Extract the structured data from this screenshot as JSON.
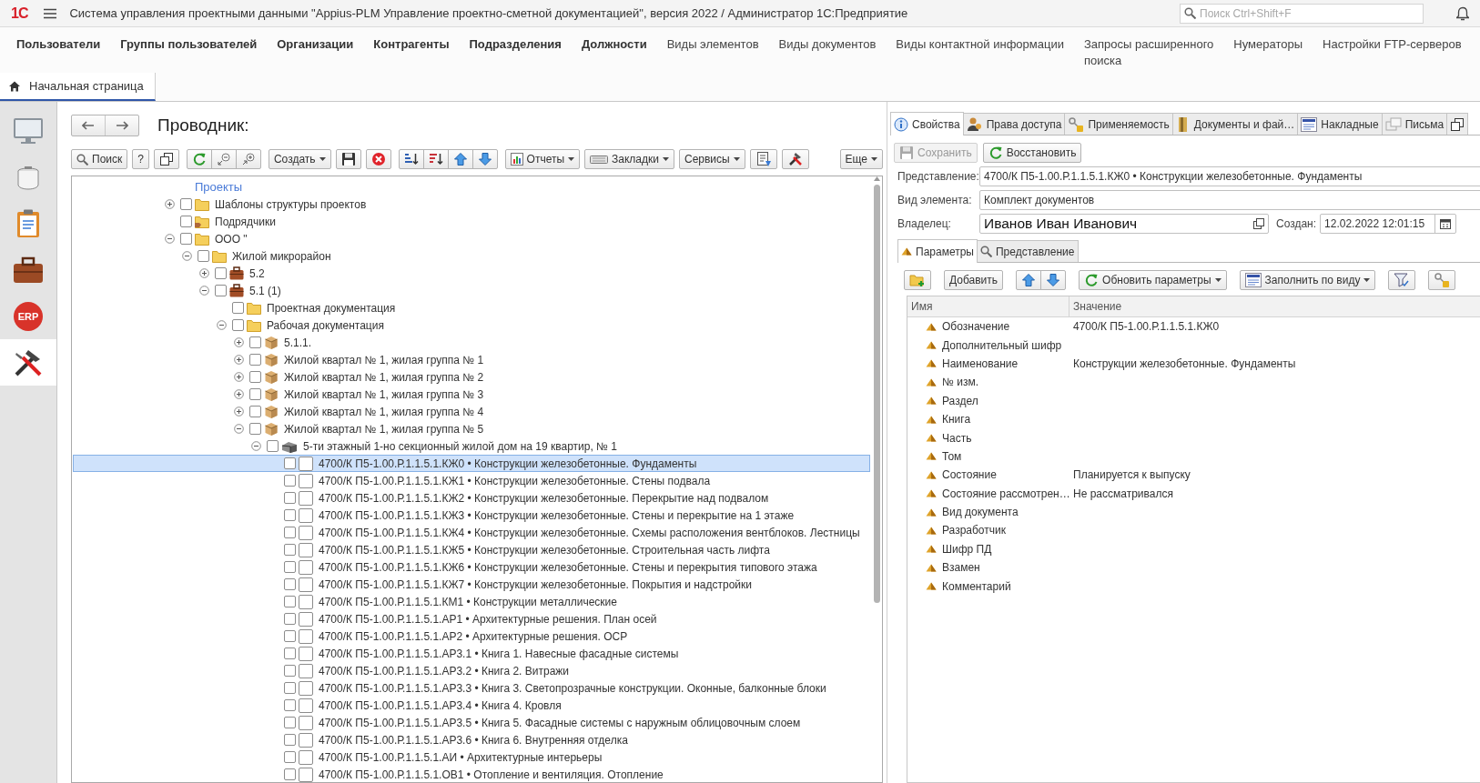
{
  "title_bar": {
    "logo": "1С",
    "title": "Система управления проектными данными \"Appius-PLM Управление проектно-сметной документацией\", версия 2022 / Администратор 1С:Предприятие",
    "search": {
      "placeholder": "Поиск Ctrl+Shift+F"
    }
  },
  "nav_bar": {
    "items": [
      {
        "label": "Пользователи",
        "emphasized": true
      },
      {
        "label": "Группы пользователей",
        "emphasized": true
      },
      {
        "label": "Организации",
        "emphasized": true
      },
      {
        "label": "Контрагенты",
        "emphasized": true
      },
      {
        "label": "Подразделения",
        "emphasized": true
      },
      {
        "label": "Должности",
        "emphasized": true
      },
      {
        "label": "Виды элементов",
        "emphasized": false
      },
      {
        "label": "Виды документов",
        "emphasized": false
      },
      {
        "label": "Виды контактной информации",
        "emphasized": false
      },
      {
        "label": "Запросы расширенного\nпоиска",
        "emphasized": false
      },
      {
        "label": "Нумераторы",
        "emphasized": false
      },
      {
        "label": "Настройки FTP-серверов",
        "emphasized": false
      }
    ]
  },
  "open_tabs": [
    {
      "label": "Начальная страница",
      "selected": true
    }
  ],
  "sidebar": {
    "items": [
      {
        "kind": "monitor",
        "selected": false
      },
      {
        "kind": "pot",
        "selected": false
      },
      {
        "kind": "clipboard",
        "selected": false
      },
      {
        "kind": "briefcase",
        "selected": false
      },
      {
        "kind": "erp",
        "label": "ERP",
        "selected": false
      },
      {
        "kind": "tools",
        "selected": true
      }
    ]
  },
  "explorer": {
    "title": "Проводник:",
    "toolbar": [
      {
        "kind": "search",
        "label": "Поиск"
      },
      {
        "kind": "help",
        "label": "?"
      },
      {
        "kind": "copy"
      },
      {
        "kind": "group",
        "items": [
          {
            "kind": "refresh"
          },
          {
            "kind": "collapse"
          },
          {
            "kind": "expand"
          }
        ]
      },
      {
        "kind": "create",
        "label": "Создать"
      },
      {
        "kind": "save"
      },
      {
        "kind": "cancel"
      },
      {
        "kind": "group",
        "items": [
          {
            "kind": "sort-asc"
          },
          {
            "kind": "sort-desc"
          },
          {
            "kind": "move-up"
          },
          {
            "kind": "move-down"
          }
        ]
      },
      {
        "kind": "reports",
        "label": "Отчеты"
      },
      {
        "kind": "bookmarks",
        "label": "Закладки"
      },
      {
        "kind": "services",
        "label": "Сервисы"
      },
      {
        "kind": "list-settings"
      },
      {
        "kind": "tools"
      },
      {
        "kind": "more",
        "label": "Еще"
      }
    ],
    "tree": {
      "label": "Проекты",
      "selected": false,
      "children": [
        {
          "label": "Шаблоны структуры проектов",
          "kind": "folder",
          "expanded": false,
          "checked": false,
          "selected": false
        },
        {
          "label": "Подрядчики",
          "kind": "shared-folder",
          "checked": false,
          "selected": false
        },
        {
          "label": "ООО \"",
          "kind": "folder",
          "expanded": true,
          "checked": false,
          "selected": false,
          "children": [
            {
              "label": "Жилой микрорайон",
              "kind": "folder",
              "expanded": true,
              "checked": false,
              "selected": false,
              "children": [
                {
                  "label": "5.2",
                  "kind": "briefcase",
                  "expanded": false,
                  "checked": false,
                  "selected": false
                },
                {
                  "label": "5.1 (1)",
                  "kind": "briefcase",
                  "expanded": true,
                  "checked": false,
                  "selected": false,
                  "children": [
                    {
                      "label": "Проектная документация",
                      "kind": "folder",
                      "checked": false,
                      "selected": false
                    },
                    {
                      "label": "Рабочая документация",
                      "kind": "folder",
                      "expanded": true,
                      "checked": false,
                      "selected": false,
                      "children": [
                        {
                          "label": "5.1.1.",
                          "kind": "box",
                          "expanded": false,
                          "checked": false,
                          "selected": false
                        },
                        {
                          "label": "Жилой квартал № 1, жилая группа № 1",
                          "kind": "box",
                          "expanded": false,
                          "checked": false,
                          "selected": false
                        },
                        {
                          "label": "Жилой квартал № 1, жилая группа № 2",
                          "kind": "box",
                          "expanded": false,
                          "checked": false,
                          "selected": false
                        },
                        {
                          "label": "Жилой квартал № 1, жилая группа № 3",
                          "kind": "box",
                          "expanded": false,
                          "checked": false,
                          "selected": false
                        },
                        {
                          "label": "Жилой квартал № 1, жилая группа № 4",
                          "kind": "box",
                          "expanded": false,
                          "checked": false,
                          "selected": false
                        },
                        {
                          "label": "Жилой квартал № 1, жилая группа № 5",
                          "kind": "box",
                          "expanded": true,
                          "checked": false,
                          "selected": false,
                          "children": [
                            {
                              "label": "5-ти этажный 1-но секционный жилой дом на 19 квартир, № 1",
                              "kind": "building",
                              "expanded": true,
                              "checked": false,
                              "selected": false,
                              "children": [
                                {
                                  "label": "4700/К П5-1.00.Р.1.1.5.1.КЖ0 • Конструкции железобетонные. Фундаменты",
                                  "kind": "document",
                                  "checked": false,
                                  "selected": true
                                },
                                {
                                  "label": "4700/К П5-1.00.Р.1.1.5.1.КЖ1 • Конструкции железобетонные. Стены подвала",
                                  "kind": "document",
                                  "checked": false,
                                  "selected": false
                                },
                                {
                                  "label": "4700/К П5-1.00.Р.1.1.5.1.КЖ2 • Конструкции железобетонные. Перекрытие над подвалом",
                                  "kind": "document",
                                  "checked": false,
                                  "selected": false
                                },
                                {
                                  "label": "4700/К П5-1.00.Р.1.1.5.1.КЖ3 • Конструкции железобетонные. Стены и перекрытие на 1 этаже",
                                  "kind": "document",
                                  "checked": false,
                                  "selected": false
                                },
                                {
                                  "label": "4700/К П5-1.00.Р.1.1.5.1.КЖ4 • Конструкции железобетонные. Схемы расположения вентблоков. Лестницы",
                                  "kind": "document",
                                  "checked": false,
                                  "selected": false
                                },
                                {
                                  "label": "4700/К П5-1.00.Р.1.1.5.1.КЖ5 • Конструкции железобетонные. Строительная часть лифта",
                                  "kind": "document",
                                  "checked": false,
                                  "selected": false
                                },
                                {
                                  "label": "4700/К П5-1.00.Р.1.1.5.1.КЖ6 • Конструкции железобетонные. Стены и перекрытия типового этажа",
                                  "kind": "document",
                                  "checked": false,
                                  "selected": false
                                },
                                {
                                  "label": "4700/К П5-1.00.Р.1.1.5.1.КЖ7 • Конструкции железобетонные. Покрытия и надстройки",
                                  "kind": "document",
                                  "checked": false,
                                  "selected": false
                                },
                                {
                                  "label": "4700/К П5-1.00.Р.1.1.5.1.КМ1 • Конструкции металлические",
                                  "kind": "document",
                                  "checked": false,
                                  "selected": false
                                },
                                {
                                  "label": "4700/К П5-1.00.Р.1.1.5.1.АР1 • Архитектурные решения. План осей",
                                  "kind": "document",
                                  "checked": false,
                                  "selected": false
                                },
                                {
                                  "label": "4700/К П5-1.00.Р.1.1.5.1.АР2 • Архитектурные решения. ОСР",
                                  "kind": "document",
                                  "checked": false,
                                  "selected": false
                                },
                                {
                                  "label": "4700/К П5-1.00.Р.1.1.5.1.АР3.1 • Книга 1. Навесные фасадные системы",
                                  "kind": "document",
                                  "checked": false,
                                  "selected": false
                                },
                                {
                                  "label": "4700/К П5-1.00.Р.1.1.5.1.АР3.2 • Книга 2. Витражи",
                                  "kind": "document",
                                  "checked": false,
                                  "selected": false
                                },
                                {
                                  "label": "4700/К П5-1.00.Р.1.1.5.1.АР3.3 • Книга 3. Светопрозрачные конструкции. Оконные, балконные блоки",
                                  "kind": "document",
                                  "checked": false,
                                  "selected": false
                                },
                                {
                                  "label": "4700/К П5-1.00.Р.1.1.5.1.АР3.4 • Книга 4. Кровля",
                                  "kind": "document",
                                  "checked": false,
                                  "selected": false
                                },
                                {
                                  "label": "4700/К П5-1.00.Р.1.1.5.1.АР3.5 • Книга 5. Фасадные системы с наружным облицовочным слоем",
                                  "kind": "document",
                                  "checked": false,
                                  "selected": false
                                },
                                {
                                  "label": "4700/К П5-1.00.Р.1.1.5.1.АР3.6 • Книга 6. Внутренняя отделка",
                                  "kind": "document",
                                  "checked": false,
                                  "selected": false
                                },
                                {
                                  "label": "4700/К П5-1.00.Р.1.1.5.1.АИ • Архитектурные интерьеры",
                                  "kind": "document",
                                  "checked": false,
                                  "selected": false
                                },
                                {
                                  "label": "4700/К П5-1.00.Р.1.1.5.1.ОВ1 • Отопление и вентиляция. Отопление",
                                  "kind": "document",
                                  "checked": false,
                                  "selected": false
                                }
                              ]
                            }
                          ]
                        }
                      ]
                    }
                  ]
                }
              ]
            }
          ]
        }
      ]
    }
  },
  "properties": {
    "tabs": [
      {
        "kind": "info",
        "label": "Свойства",
        "selected": true
      },
      {
        "kind": "users",
        "label": "Права доступа",
        "selected": false
      },
      {
        "kind": "usage",
        "label": "Применяемость",
        "selected": false
      },
      {
        "kind": "files",
        "label": "Документы и фай…",
        "selected": false
      },
      {
        "kind": "invoices",
        "label": "Накладные",
        "selected": false
      },
      {
        "kind": "letters",
        "label": "Письма",
        "selected": false
      },
      {
        "kind": "copy",
        "selected": false
      }
    ],
    "actions": [
      {
        "kind": "save",
        "label": "Сохранить",
        "disabled": true
      },
      {
        "kind": "restore",
        "label": "Восстановить",
        "disabled": false
      }
    ],
    "representation": {
      "label": "Представление:",
      "value": "4700/К П5-1.00.Р.1.1.5.1.КЖ0 • Конструкции железобетонные. Фундаменты"
    },
    "element_type": {
      "label": "Вид элемента:",
      "value": "Комплект документов"
    },
    "owner": {
      "label": "Владелец:",
      "value": "Иванов Иван Иванович"
    },
    "created": {
      "label": "Создан:",
      "value": "12.02.2022 12:01:15"
    },
    "subtabs": [
      {
        "kind": "params",
        "label": "Параметры",
        "selected": true
      },
      {
        "kind": "view",
        "label": "Представление",
        "selected": false
      }
    ],
    "toolbar": [
      {
        "kind": "add-folder"
      },
      {
        "kind": "add",
        "label": "Добавить"
      },
      {
        "kind": "group",
        "items": [
          {
            "kind": "move-up"
          },
          {
            "kind": "move-down"
          }
        ]
      },
      {
        "kind": "refresh-params",
        "label": "Обновить параметры"
      },
      {
        "kind": "fill",
        "label": "Заполнить по виду"
      },
      {
        "kind": "filter"
      },
      {
        "kind": "access"
      }
    ],
    "table": {
      "columns": [
        "Имя",
        "Значение"
      ],
      "rows": [
        {
          "name": "Обозначение",
          "value": "4700/К П5-1.00.Р.1.1.5.1.КЖ0"
        },
        {
          "name": "Дополнительный шифр"
        },
        {
          "name": "Наименование",
          "value": "Конструкции железобетонные. Фундаменты"
        },
        {
          "name": "№ изм."
        },
        {
          "name": "Раздел"
        },
        {
          "name": "Книга"
        },
        {
          "name": "Часть"
        },
        {
          "name": "Том"
        },
        {
          "name": "Состояние",
          "value": "Планируется к выпуску"
        },
        {
          "name": "Состояние рассмотрен…",
          "value": "Не рассматривался"
        },
        {
          "name": "Вид документа"
        },
        {
          "name": "Разработчик"
        },
        {
          "name": "Шифр ПД"
        },
        {
          "name": "Взамен"
        },
        {
          "name": "Комментарий"
        }
      ]
    }
  }
}
